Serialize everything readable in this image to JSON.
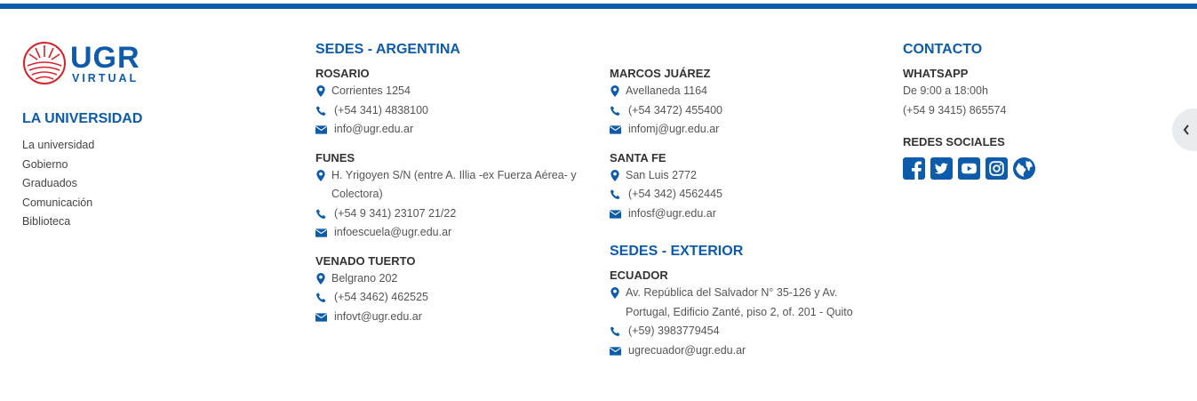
{
  "colors": {
    "brand_blue": "#0d5bab",
    "logo_red": "#d8232a"
  },
  "logo": {
    "main": "UGR",
    "sub": "VIRTUAL"
  },
  "universidad": {
    "title": "LA UNIVERSIDAD",
    "links": [
      "La universidad",
      "Gobierno",
      "Graduados",
      "Comunicación",
      "Biblioteca"
    ]
  },
  "sedes_argentina": {
    "title": "SEDES - ARGENTINA",
    "rosario": {
      "name": "ROSARIO",
      "address": "Corrientes 1254",
      "phone": "(+54 341) 4838100",
      "email": "info@ugr.edu.ar"
    },
    "funes": {
      "name": "FUNES",
      "address": "H. Yrigoyen S/N (entre A. Illia -ex Fuerza Aérea- y Colectora)",
      "phone": "(+54 9 341) 23107 21/22",
      "email": "infoescuela@ugr.edu.ar"
    },
    "venado": {
      "name": "VENADO TUERTO",
      "address": "Belgrano 202",
      "phone": "(+54 3462) 462525",
      "email": "infovt@ugr.edu.ar"
    },
    "marcos": {
      "name": "MARCOS JUÁREZ",
      "address": "Avellaneda 1164",
      "phone": "(+54 3472) 455400",
      "email": "infomj@ugr.edu.ar"
    },
    "santafe": {
      "name": "SANTA FE",
      "address": "San Luis 2772",
      "phone": "(+54 342) 4562445",
      "email": "infosf@ugr.edu.ar"
    }
  },
  "sedes_exterior": {
    "title": "SEDES - EXTERIOR",
    "ecuador": {
      "name": "ECUADOR",
      "address": "Av. República del Salvador N° 35-126 y Av. Portugal, Edificio Zanté, piso 2, of. 201 - Quito",
      "phone": "(+59) 3983779454",
      "email": "ugrecuador@ugr.edu.ar"
    }
  },
  "contacto": {
    "title": "CONTACTO",
    "whatsapp_label": "WHATSAPP",
    "hours": "De 9:00 a 18:00h",
    "phone": "(+54 9 3415) 865574",
    "redes_label": "REDES SOCIALES",
    "social_icons": [
      "facebook-icon",
      "twitter-icon",
      "youtube-icon",
      "instagram-icon",
      "globe-icon"
    ]
  }
}
